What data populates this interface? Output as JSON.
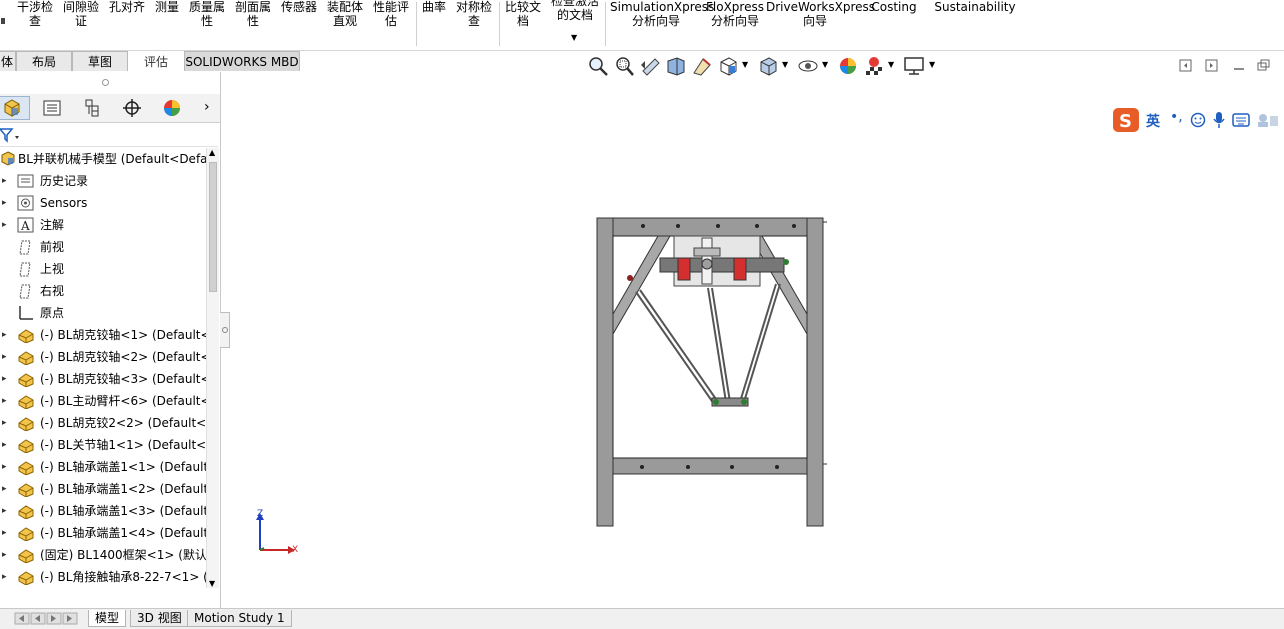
{
  "ribbon": {
    "items": [
      {
        "label": "干涉检\n查"
      },
      {
        "label": "间隙验\n证"
      },
      {
        "label": "孔对齐"
      },
      {
        "label": "测量"
      },
      {
        "label": "质量属\n性"
      },
      {
        "label": "剖面属\n性"
      },
      {
        "label": "传感器"
      },
      {
        "label": "装配体\n直观"
      },
      {
        "label": "性能评\n估"
      },
      {
        "label": "曲率"
      },
      {
        "label": "对称检\n查"
      },
      {
        "label": "比较文\n档"
      },
      {
        "label": "检查激活\n的文档"
      },
      {
        "label": "SimulationXpress\n分析向导"
      },
      {
        "label": "FloXpress\n分析向导"
      },
      {
        "label": "DriveWorksXpress\n向导"
      },
      {
        "label": "Costing"
      },
      {
        "label": "Sustainability"
      }
    ]
  },
  "command_tabs": [
    "体",
    "布局",
    "草图",
    "评估",
    "SOLIDWORKS MBD"
  ],
  "feature_tree": {
    "root": "BL并联机械手模型  (Default<Defa",
    "items": [
      {
        "label": "历史记录",
        "icon": "history-folder-icon"
      },
      {
        "label": "Sensors",
        "icon": "sensor-icon"
      },
      {
        "label": "注解",
        "icon": "annotation-icon"
      },
      {
        "label": "前视",
        "icon": "plane-icon"
      },
      {
        "label": "上视",
        "icon": "plane-icon"
      },
      {
        "label": "右视",
        "icon": "plane-icon"
      },
      {
        "label": "原点",
        "icon": "origin-icon"
      },
      {
        "label": "(-) BL胡克铰轴<1> (Default<",
        "icon": "part-icon"
      },
      {
        "label": "(-) BL胡克铰轴<2> (Default<",
        "icon": "part-icon"
      },
      {
        "label": "(-) BL胡克铰轴<3> (Default<",
        "icon": "part-icon"
      },
      {
        "label": "(-) BL主动臂杆<6> (Default<",
        "icon": "part-icon"
      },
      {
        "label": "(-) BL胡克铰2<2> (Default<<",
        "icon": "part-icon"
      },
      {
        "label": "(-) BL关节轴1<1> (Default<<",
        "icon": "part-icon"
      },
      {
        "label": "(-) BL轴承端盖1<1> (Default<",
        "icon": "part-icon"
      },
      {
        "label": "(-) BL轴承端盖1<2> (Default<",
        "icon": "part-icon"
      },
      {
        "label": "(-) BL轴承端盖1<3> (Default<",
        "icon": "part-icon"
      },
      {
        "label": "(-) BL轴承端盖1<4> (Default<",
        "icon": "part-icon"
      },
      {
        "label": "(固定) BL1400框架<1> (默认<",
        "icon": "part-icon"
      },
      {
        "label": "(-) BL角接触轴承8-22-7<1> (D",
        "icon": "part-icon"
      }
    ]
  },
  "triad": {
    "x": "X",
    "z": "Z"
  },
  "ime_toolbar": {
    "lang": "英"
  },
  "bottom_tabs": [
    "模型",
    "3D 视图",
    "Motion Study 1"
  ],
  "colors": {
    "accent": "#1f5fbf",
    "ime_logo": "#e85d27"
  }
}
